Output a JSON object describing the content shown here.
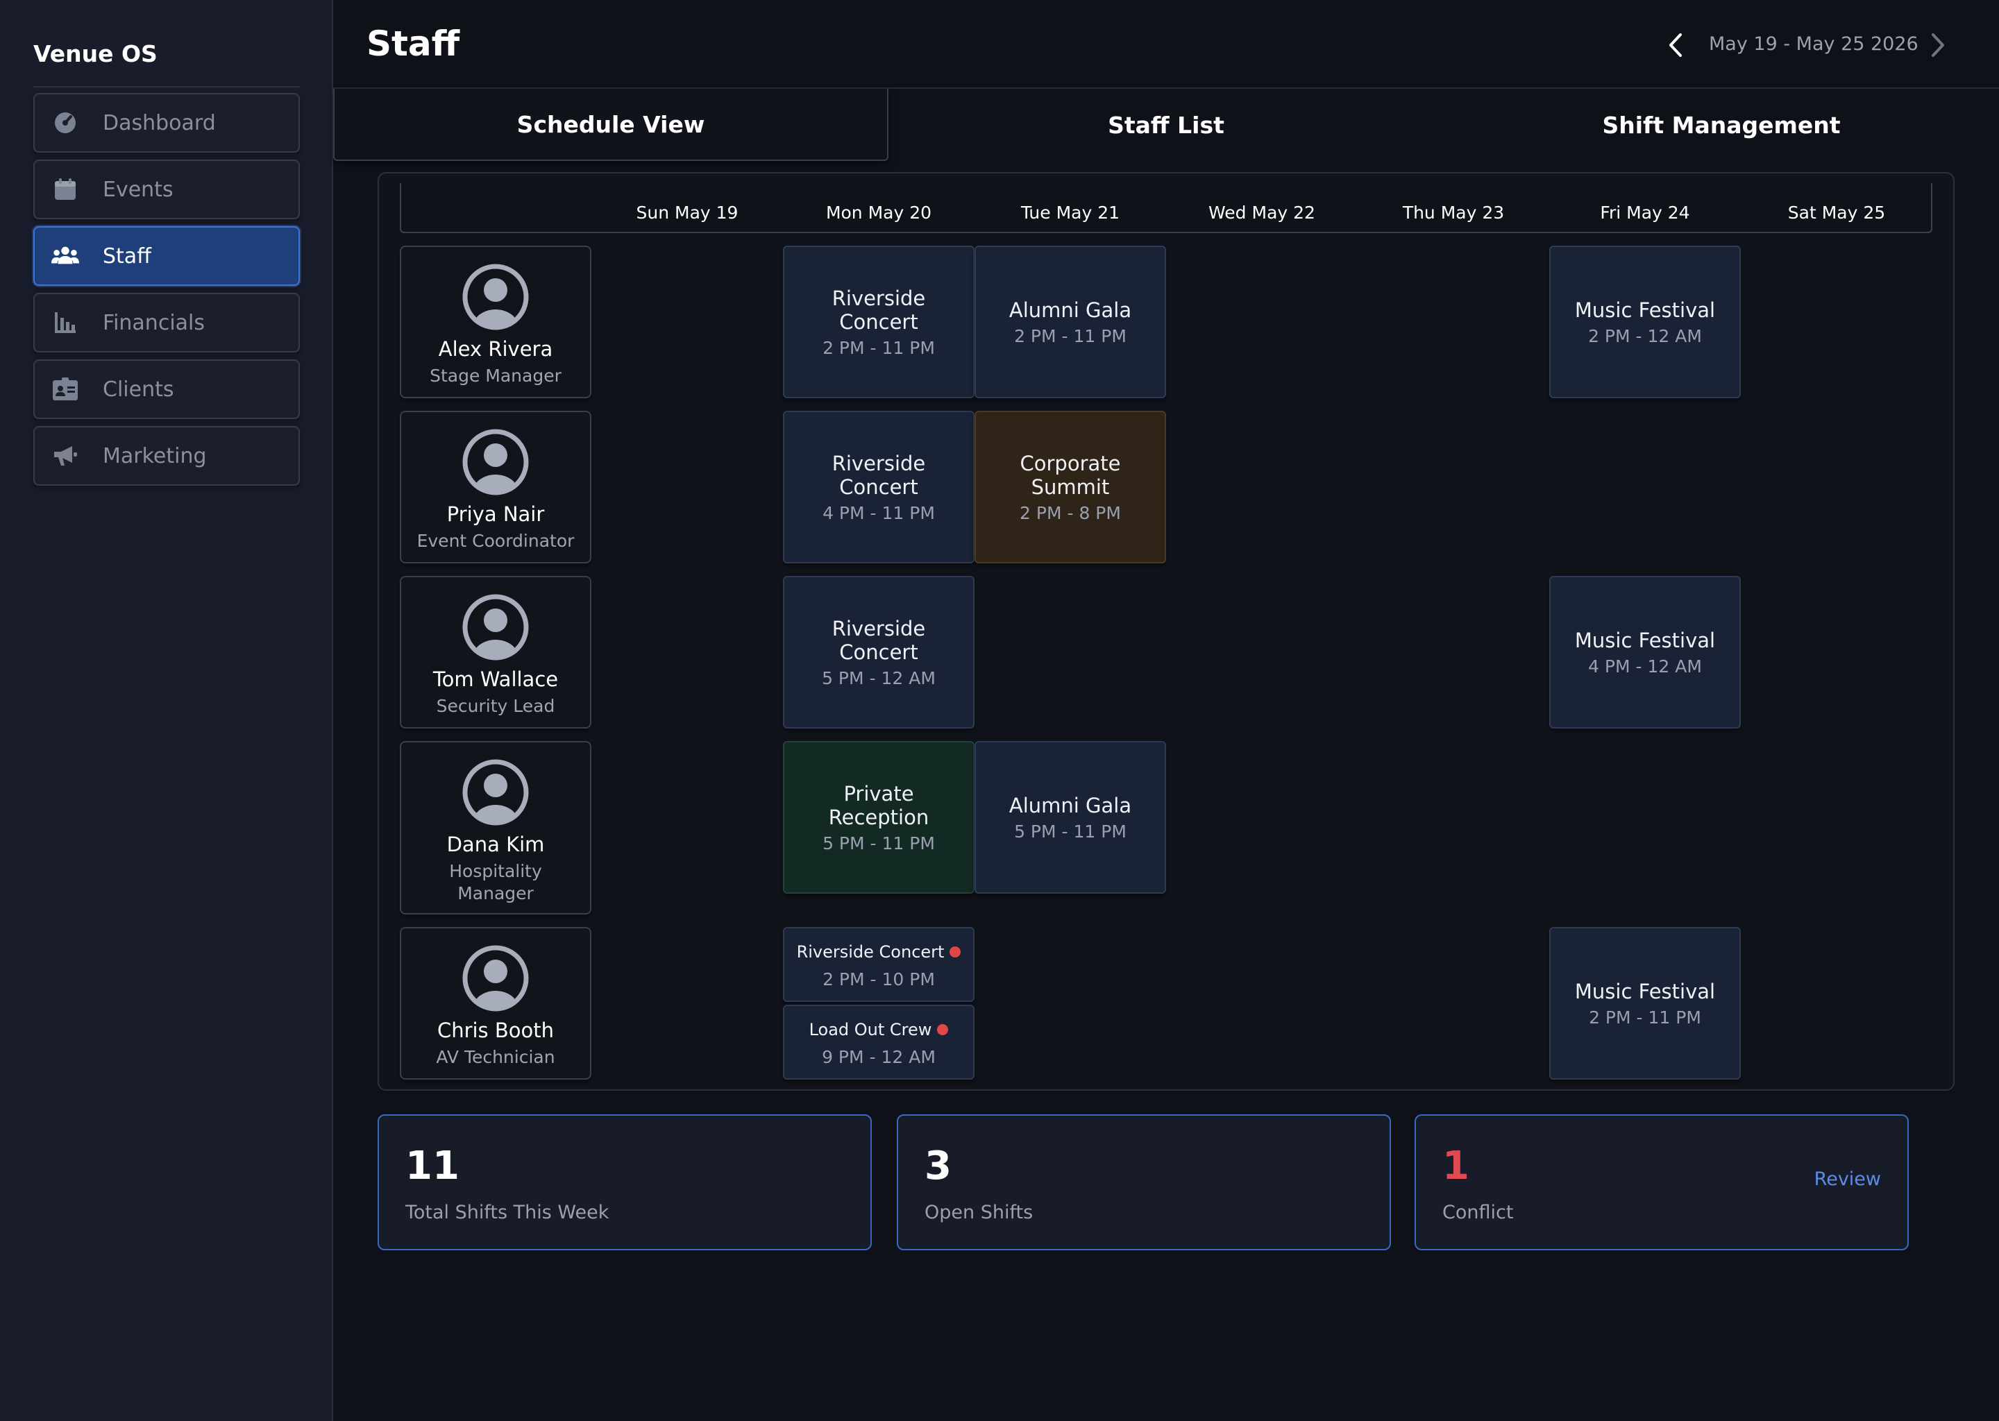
{
  "app": {
    "title": "Venue OS"
  },
  "sidebar": {
    "items": [
      {
        "label": "Dashboard",
        "icon": "dashboard-icon",
        "active": false
      },
      {
        "label": "Events",
        "icon": "calendar-icon",
        "active": false
      },
      {
        "label": "Staff",
        "icon": "users-icon",
        "active": true
      },
      {
        "label": "Financials",
        "icon": "bar-chart-icon",
        "active": false
      },
      {
        "label": "Clients",
        "icon": "id-card-icon",
        "active": false
      },
      {
        "label": "Marketing",
        "icon": "megaphone-icon",
        "active": false
      }
    ]
  },
  "header": {
    "title": "Staff",
    "date_range": "May 19 - May 25 2026"
  },
  "tabs": [
    {
      "label": "Schedule View",
      "active": true
    },
    {
      "label": "Staff List",
      "active": false
    },
    {
      "label": "Shift Management",
      "active": false
    }
  ],
  "schedule": {
    "days": [
      "Sun May 19",
      "Mon May 20",
      "Tue May 21",
      "Wed May 22",
      "Thu May 23",
      "Fri May 24",
      "Sat May 25"
    ],
    "staff": [
      {
        "name": "Alex Rivera",
        "role": "Stage Manager"
      },
      {
        "name": "Priya Nair",
        "role": "Event Coordinator"
      },
      {
        "name": "Tom Wallace",
        "role": "Security Lead"
      },
      {
        "name": "Dana Kim",
        "role": "Hospitality Manager"
      },
      {
        "name": "Chris Booth",
        "role": "AV Technician"
      }
    ],
    "shifts": {
      "alex_mon": {
        "title": "Riverside Concert",
        "time": "2 PM - 11 PM"
      },
      "alex_tue": {
        "title": "Alumni Gala",
        "time": "2 PM - 11 PM"
      },
      "alex_fri": {
        "title": "Music Festival",
        "time": "2 PM - 12 AM"
      },
      "priya_mon": {
        "title": "Riverside Concert",
        "time": "4 PM - 11 PM"
      },
      "priya_tue": {
        "title": "Corporate Summit",
        "time": "2 PM - 8 PM"
      },
      "tom_mon": {
        "title": "Riverside Concert",
        "time": "5 PM - 12 AM"
      },
      "tom_fri": {
        "title": "Music Festival",
        "time": "4 PM - 12 AM"
      },
      "dana_mon": {
        "title": "Private Reception",
        "time": "5 PM - 11 PM"
      },
      "dana_tue": {
        "title": "Alumni Gala",
        "time": "5 PM - 11 PM"
      },
      "chris_mon_1": {
        "title": "Riverside Concert",
        "time": "2 PM - 10 PM"
      },
      "chris_mon_2": {
        "title": "Load Out Crew",
        "time": "9 PM - 12 AM"
      },
      "chris_fri": {
        "title": "Music Festival",
        "time": "2 PM - 11 PM"
      }
    }
  },
  "stats": {
    "total": {
      "value": "11",
      "label": "Total Shifts This Week"
    },
    "open": {
      "value": "3",
      "label": "Open Shifts"
    },
    "conflict": {
      "value": "1",
      "label": "Conflict",
      "action": "Review"
    }
  },
  "colors": {
    "accent": "#3f73d6",
    "conflict": "#e04848",
    "shift_default": "#1a2236",
    "shift_corporate": "#2e2418",
    "shift_private": "#132a24"
  }
}
